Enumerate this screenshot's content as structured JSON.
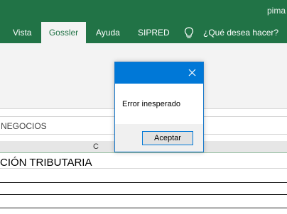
{
  "window": {
    "user": "pima"
  },
  "ribbon": {
    "tabs": [
      {
        "label": "Vista"
      },
      {
        "label": "Gossler",
        "active": true
      },
      {
        "label": "Ayuda"
      },
      {
        "label": "SIPRED"
      }
    ],
    "tell_me": "¿Qué desea hacer?"
  },
  "formula_bar": {
    "content": "NEGOCIOS"
  },
  "columns": [
    "C"
  ],
  "sheet": {
    "cell_text": "CIÓN TRIBUTARIA"
  },
  "dialog": {
    "message": "Error inesperado",
    "ok_label": "Aceptar"
  },
  "colors": {
    "excel_green": "#217346",
    "dialog_blue": "#0078d7"
  }
}
